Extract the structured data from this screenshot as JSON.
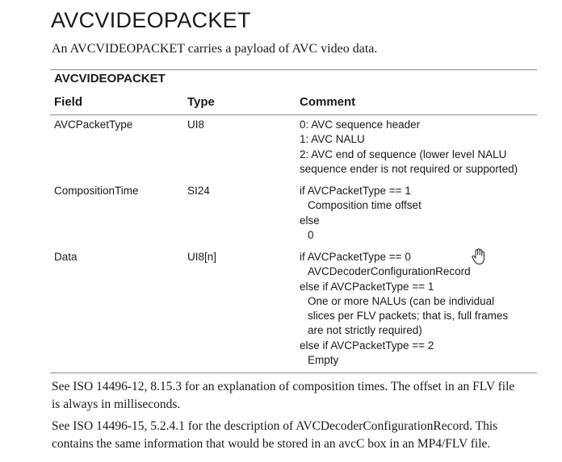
{
  "heading": "AVCVIDEOPACKET",
  "intro": "An AVCVIDEOPACKET carries a payload of AVC video data.",
  "table": {
    "title": "AVCVIDEOPACKET",
    "headers": {
      "field": "Field",
      "type": "Type",
      "comment": "Comment"
    },
    "rows": [
      {
        "field": "AVCPacketType",
        "type": "UI8",
        "comment": [
          "0: AVC sequence header",
          "1: AVC NALU",
          "2: AVC end of sequence (lower level NALU",
          "sequence ender is not required or supported)"
        ]
      },
      {
        "field": "CompositionTime",
        "type": "SI24",
        "comment": [
          "if AVCPacketType == 1",
          "Composition time offset",
          "else",
          "0"
        ]
      },
      {
        "field": "Data",
        "type": "UI8[n]",
        "comment": [
          "if AVCPacketType == 0",
          "AVCDecoderConfigurationRecord",
          "else if AVCPacketType == 1",
          "One or more NALUs (can be individual",
          "slices per FLV packets; that is, full frames",
          "are not strictly required)",
          "else if AVCPacketType == 2",
          "Empty"
        ]
      }
    ]
  },
  "notes": [
    {
      "line1": "See ISO 14496-12, 8.15.3 for an explanation of composition times. The offset in an FLV file",
      "line2": "is always in milliseconds."
    },
    {
      "line1": "See ISO 14496-15, 5.2.4.1 for the description of AVCDecoderConfigurationRecord. This",
      "line2": "contains the same information that would be stored in an avcC box in an MP4/FLV file."
    }
  ],
  "cursor_icon": "hand-pointer-icon"
}
